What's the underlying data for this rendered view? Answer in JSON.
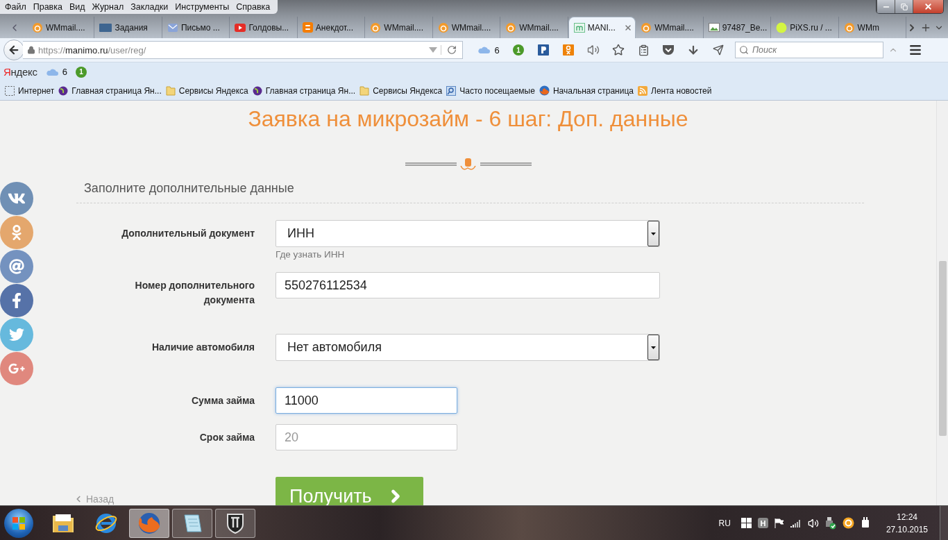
{
  "menu_bar": [
    "Файл",
    "Правка",
    "Вид",
    "Журнал",
    "Закладки",
    "Инструменты",
    "Справка"
  ],
  "tabs": [
    {
      "kind": "wmmail",
      "label": "WMmail....",
      "selected": false
    },
    {
      "kind": "vk",
      "label": "Задания",
      "selected": false
    },
    {
      "kind": "mail",
      "label": "Письмо ...",
      "selected": false
    },
    {
      "kind": "video",
      "label": "Голдовы...",
      "selected": false
    },
    {
      "kind": "blog",
      "label": "Анекдот...",
      "selected": false
    },
    {
      "kind": "wmmail",
      "label": "WMmail....",
      "selected": false
    },
    {
      "kind": "wmmail",
      "label": "WMmail....",
      "selected": false
    },
    {
      "kind": "wmmail",
      "label": "WMmail....",
      "selected": false
    },
    {
      "kind": "manimo",
      "label": "MANI...",
      "selected": true
    },
    {
      "kind": "wmmail",
      "label": "WMmail....",
      "selected": false
    },
    {
      "kind": "image",
      "label": "97487_Be...",
      "selected": false
    },
    {
      "kind": "dot",
      "label": "PiXS.ru / ...",
      "selected": false
    },
    {
      "kind": "wmmail",
      "label": "WMm",
      "selected": false
    }
  ],
  "nav": {
    "url": {
      "scheme": "https://",
      "host": "manimo.ru",
      "path": "/user/reg/"
    },
    "weather": "6",
    "badge": "1",
    "search": {
      "placeholder": "Поиск"
    }
  },
  "yandex_bar": {
    "logo": "Яндекс",
    "weather": "6",
    "badge": "1"
  },
  "bookmarks": [
    {
      "kind": "dashed",
      "label": "Интернет"
    },
    {
      "kind": "globe",
      "label": "Главная страница Ян..."
    },
    {
      "kind": "folder",
      "label": "Сервисы Яндекса"
    },
    {
      "kind": "globe",
      "label": "Главная страница Ян..."
    },
    {
      "kind": "folder",
      "label": "Сервисы Яндекса"
    },
    {
      "kind": "search",
      "label": "Часто посещаемые"
    },
    {
      "kind": "fox",
      "label": "Начальная страница"
    },
    {
      "kind": "rss",
      "label": "Лента новостей"
    }
  ],
  "social": [
    {
      "kind": "vk",
      "color": "#6a8bb2"
    },
    {
      "kind": "ok",
      "color": "#e4a466"
    },
    {
      "kind": "at",
      "color": "#6e8dbd"
    },
    {
      "kind": "fb",
      "color": "#4e6ca5"
    },
    {
      "kind": "tw",
      "color": "#5fb7dc"
    },
    {
      "kind": "gplus",
      "color": "#e08378"
    }
  ],
  "page": {
    "title": "Заявка на микрозайм - 6 шаг: Доп. данные",
    "section": "Заполните дополнительные данные",
    "fields": [
      {
        "kind": "select",
        "label": "Дополнительный документ",
        "value": "ИНН",
        "hint": "Где узнать ИНН"
      },
      {
        "kind": "text",
        "label": "Номер дополнительного документа",
        "value": "550276112534",
        "focused": false,
        "short": false
      },
      {
        "kind": "select",
        "label": "Наличие автомобиля",
        "value": "Нет автомобиля"
      },
      {
        "kind": "text",
        "label": "Сумма займа",
        "value": "11000",
        "focused": true,
        "short": true
      },
      {
        "kind": "text",
        "label": "Срок займа",
        "placeholder": "20",
        "focused": false,
        "short": true
      }
    ],
    "submit": "Получить",
    "back": "Назад"
  },
  "taskbar": {
    "apps": [
      {
        "kind": "explorer",
        "running": false,
        "selected": false
      },
      {
        "kind": "ie",
        "running": false,
        "selected": false
      },
      {
        "kind": "firefox",
        "running": true,
        "selected": true
      },
      {
        "kind": "notepad",
        "running": true,
        "selected": false
      },
      {
        "kind": "shield",
        "running": true,
        "selected": false
      }
    ],
    "language": "RU",
    "tray_badge": "H",
    "time": "12:24",
    "date": "27.10.2015"
  }
}
